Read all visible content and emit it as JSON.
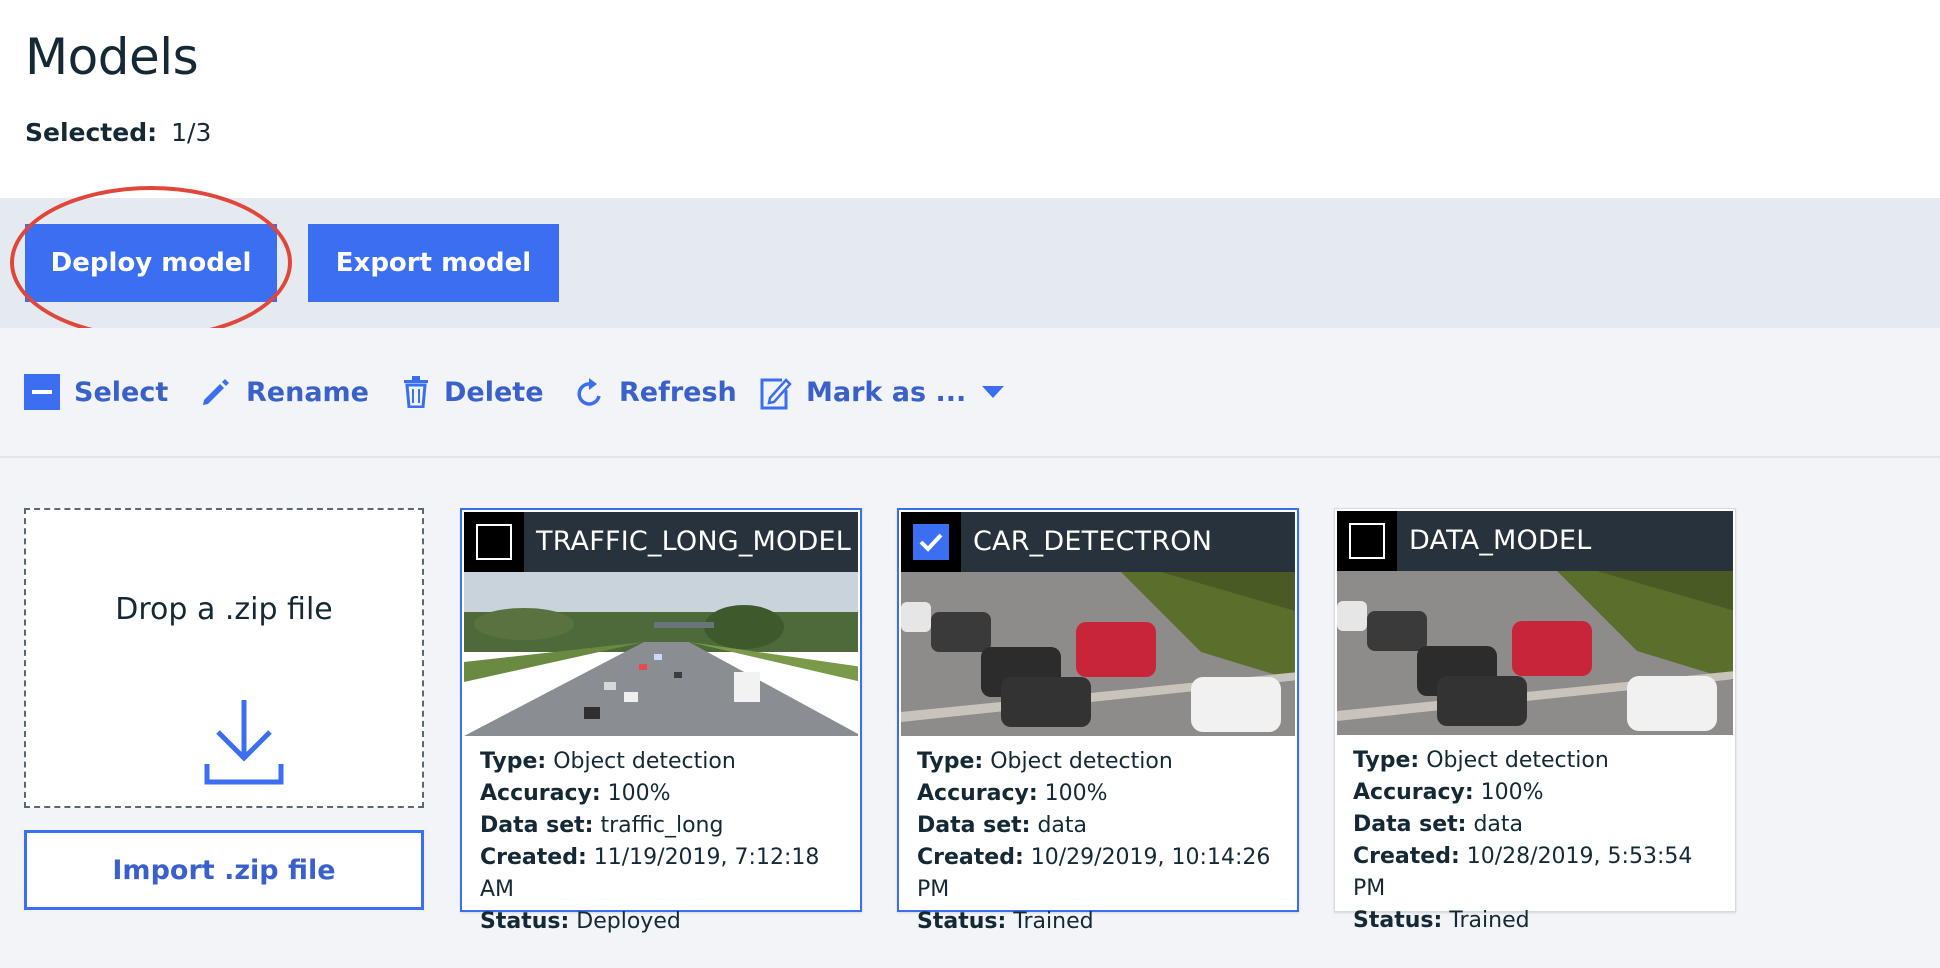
{
  "page": {
    "title": "Models",
    "selected_label": "Selected:",
    "selected_value": "1/3"
  },
  "actions": {
    "deploy_label": "Deploy model",
    "export_label": "Export model",
    "highlight_color": "#e0473a"
  },
  "toolbar": {
    "select_label": "Select",
    "rename_label": "Rename",
    "delete_label": "Delete",
    "refresh_label": "Refresh",
    "mark_label": "Mark as ..."
  },
  "import": {
    "drop_text": "Drop a .zip file",
    "button_label": "Import .zip file"
  },
  "colors": {
    "accent": "#3b6ef0",
    "link": "#3961c9",
    "card_header": "#27323c"
  },
  "cards": [
    {
      "name": "TRAFFIC_LONG_MODEL",
      "checked": false,
      "type_label": "Type:",
      "type": "Object detection",
      "accuracy_label": "Accuracy:",
      "accuracy": "100%",
      "dataset_label": "Data set:",
      "dataset": "traffic_long",
      "created_label": "Created:",
      "created": "11/19/2019, 7:12:18 AM",
      "status_label": "Status:",
      "status": "Deployed"
    },
    {
      "name": "CAR_DETECTRON",
      "checked": true,
      "type_label": "Type:",
      "type": "Object detection",
      "accuracy_label": "Accuracy:",
      "accuracy": "100%",
      "dataset_label": "Data set:",
      "dataset": "data",
      "created_label": "Created:",
      "created": "10/29/2019, 10:14:26 PM",
      "status_label": "Status:",
      "status": "Trained"
    },
    {
      "name": "DATA_MODEL",
      "checked": false,
      "type_label": "Type:",
      "type": "Object detection",
      "accuracy_label": "Accuracy:",
      "accuracy": "100%",
      "dataset_label": "Data set:",
      "dataset": "data",
      "created_label": "Created:",
      "created": "10/28/2019, 5:53:54 PM",
      "status_label": "Status:",
      "status": "Trained"
    }
  ]
}
